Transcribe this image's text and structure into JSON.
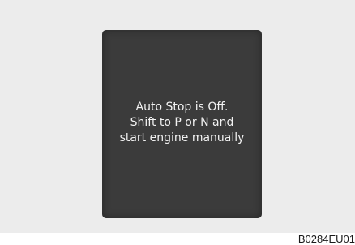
{
  "display": {
    "message_lines": [
      "Auto Stop is Off.",
      "Shift to P or N and",
      "start engine manually"
    ]
  },
  "figure_code": "B0284EU01",
  "colors": {
    "background": "#ececec",
    "screen": "#3b3b3b",
    "text": "#f2f2f2"
  }
}
